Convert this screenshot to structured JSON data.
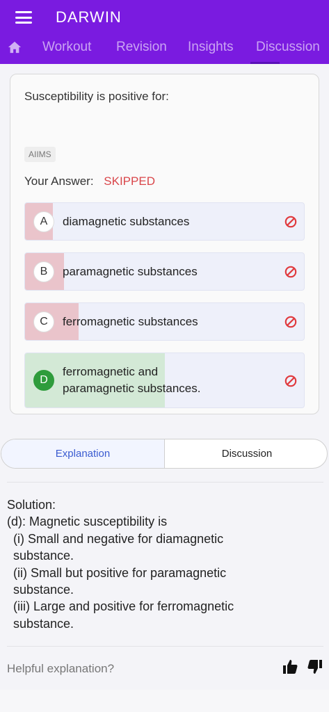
{
  "app": {
    "title": "DARWIN",
    "accent": "#7a1be0",
    "tabs": [
      {
        "label": "Workout"
      },
      {
        "label": "Revision"
      },
      {
        "label": "Insights"
      },
      {
        "label": "Discussion"
      }
    ]
  },
  "question": {
    "text": "Susceptibility is positive for:",
    "tag": "AIIMS",
    "your_answer_label": "Your Answer:",
    "your_answer_value": "SKIPPED",
    "options": [
      {
        "letter": "A",
        "text": "diamagnetic substances",
        "status": "incorrect"
      },
      {
        "letter": "B",
        "text": "paramagnetic substances",
        "status": "incorrect"
      },
      {
        "letter": "C",
        "text": "ferromagnetic substances",
        "status": "incorrect"
      },
      {
        "letter": "D",
        "text": "ferromagnetic and paramagnetic substances.",
        "text_line1": "ferromagnetic and",
        "text_line2": "paramagnetic substances.",
        "status": "correct"
      }
    ]
  },
  "segment": {
    "explanation_label": "Explanation",
    "discussion_label": "Discussion"
  },
  "solution": {
    "heading": "Solution:",
    "line1": "(d): Magnetic susceptibility is",
    "line2": "(i) Small and negative for diamagnetic",
    "line3": "substance.",
    "line4": "(ii) Small but positive for paramagnetic",
    "line5": "substance.",
    "line6": "(iii) Large and positive for ferromagnetic",
    "line7": "substance."
  },
  "feedback": {
    "prompt": "Helpful explanation?"
  },
  "colors": {
    "incorrect_fill": "#eac4cb",
    "correct_fill": "#d3e9d6",
    "correct_badge": "#2e9c3c",
    "skipped_text": "#d9464a"
  }
}
